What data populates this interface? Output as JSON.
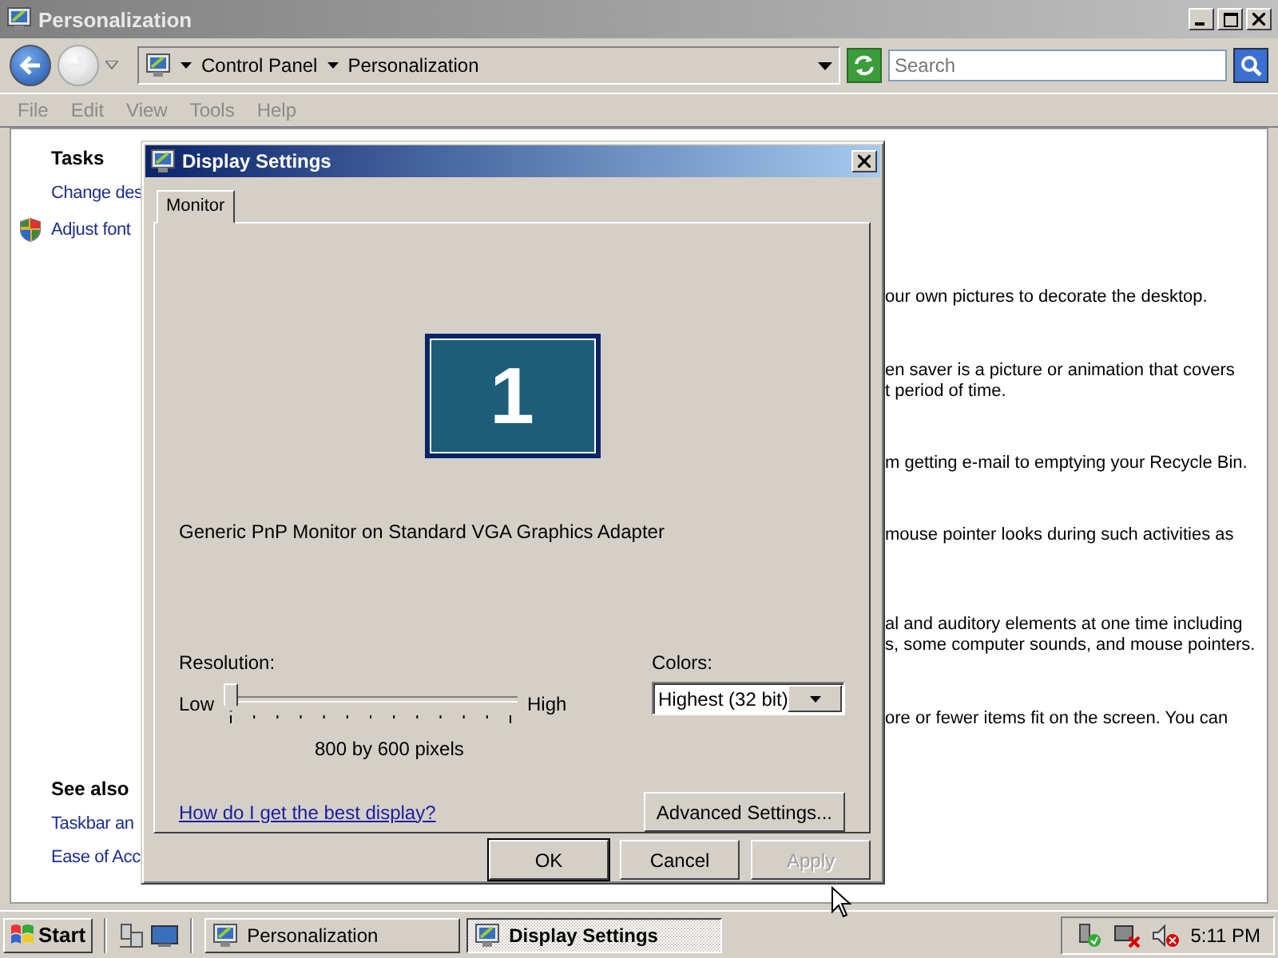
{
  "window": {
    "title": "Personalization",
    "path": [
      "Control Panel",
      "Personalization"
    ],
    "search": {
      "placeholder": "Search"
    },
    "menu": [
      "File",
      "Edit",
      "View",
      "Tools",
      "Help"
    ]
  },
  "tasks": {
    "heading": "Tasks",
    "links": [
      {
        "label": "Change des",
        "shield": false
      },
      {
        "label": "Adjust font",
        "shield": true
      }
    ]
  },
  "see_also": {
    "heading": "See also",
    "links": [
      "Taskbar an",
      "Ease of Acc"
    ]
  },
  "descriptions": [
    [
      "our own pictures to decorate the desktop."
    ],
    [
      "en saver is a picture or animation that covers",
      "t period of time."
    ],
    [
      "m getting e-mail to emptying your Recycle Bin."
    ],
    [
      "mouse pointer looks during such activities as"
    ],
    [
      "al and auditory elements at one time including",
      "s, some computer sounds, and mouse pointers."
    ],
    [
      "ore or fewer items fit on the screen. You can"
    ]
  ],
  "dialog": {
    "title": "Display Settings",
    "tabs": [
      {
        "label": "Monitor",
        "selected": true
      }
    ],
    "monitor_number": "1",
    "adapter": "Generic PnP Monitor on Standard VGA Graphics Adapter",
    "resolution": {
      "label": "Resolution:",
      "low": "Low",
      "high": "High",
      "level": 0,
      "reading": "800 by 600 pixels"
    },
    "colors": {
      "label": "Colors:",
      "value": "Highest (32 bit)"
    },
    "help_link": "How do I get the best display?",
    "advanced_button": "Advanced Settings...",
    "buttons": [
      {
        "label": "OK",
        "disabled": false,
        "default": true
      },
      {
        "label": "Cancel",
        "disabled": false,
        "default": false
      },
      {
        "label": "Apply",
        "disabled": true,
        "default": false
      }
    ]
  },
  "taskbar": {
    "start": "Start",
    "tasks": [
      {
        "label": "Personalization",
        "selected": false
      },
      {
        "label": "Display Settings",
        "selected": true
      }
    ],
    "clock": "5:11 PM"
  }
}
